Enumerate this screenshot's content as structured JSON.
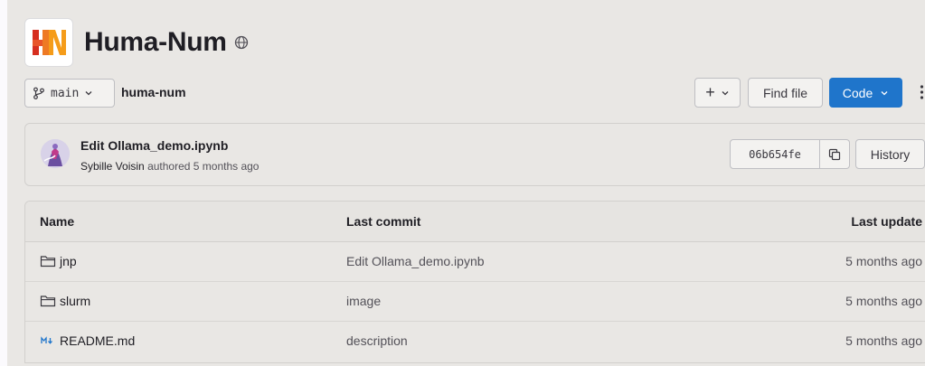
{
  "project": {
    "name": "Huma-Num",
    "visibility_icon": "globe-icon"
  },
  "toolbar": {
    "branch": "main",
    "breadcrumb_project": "huma-num",
    "plus_label": "+",
    "find_file_label": "Find file",
    "code_label": "Code"
  },
  "last_commit": {
    "title": "Edit Ollama_demo.ipynb",
    "author": "Sybille Voisin",
    "meta_suffix": "authored 5 months ago",
    "sha": "06b654fe",
    "history_label": "History"
  },
  "table": {
    "headers": {
      "name": "Name",
      "last_commit": "Last commit",
      "last_update": "Last update"
    },
    "rows": [
      {
        "name": "jnp",
        "type_icon": "folder-icon",
        "commit": "Edit Ollama_demo.ipynb",
        "updated": "5 months ago"
      },
      {
        "name": "slurm",
        "type_icon": "folder-icon",
        "commit": "image",
        "updated": "5 months ago"
      },
      {
        "name": "README.md",
        "type_icon": "markdown-icon",
        "commit": "description",
        "updated": "5 months ago"
      }
    ]
  },
  "colors": {
    "background": "#e9e7e4",
    "primary_button": "#1f75cb",
    "logo_red": "#d62e1f",
    "logo_orange": "#f59c1a"
  }
}
